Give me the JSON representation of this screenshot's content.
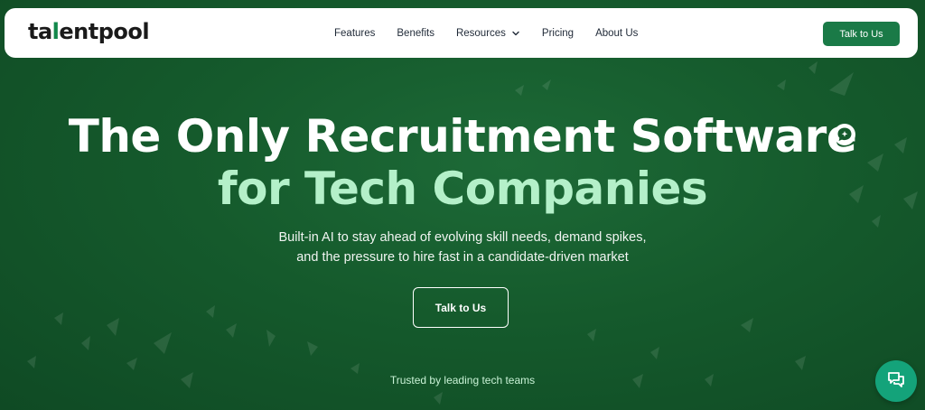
{
  "brand": {
    "logo_part1": "ta",
    "logo_accent": "l",
    "logo_part2": "entpool"
  },
  "nav": {
    "links": [
      {
        "label": "Features"
      },
      {
        "label": "Benefits"
      },
      {
        "label": "Resources",
        "has_dropdown": true
      },
      {
        "label": "Pricing"
      },
      {
        "label": "About Us"
      }
    ],
    "cta_label": "Talk to Us"
  },
  "hero": {
    "title_line1": "The Only Recruitment Software",
    "title_line2": "for Tech Companies",
    "subtitle_line1": "Built-in AI to stay ahead of evolving skill needs, demand spikes,",
    "subtitle_line2": "and the pressure to hire fast in a candidate-driven market",
    "cta_label": "Talk to Us",
    "trusted_text": "Trusted by leading tech teams"
  },
  "colors": {
    "background": "#155a2c",
    "accent_green": "#1a7a47",
    "title_highlight": "#b4f0c9",
    "chat_button": "#14a37a"
  },
  "icons": {
    "sparkle": "sparkle-chat-icon",
    "chat": "chat-bubbles-icon",
    "dropdown": "chevron-down-icon"
  }
}
